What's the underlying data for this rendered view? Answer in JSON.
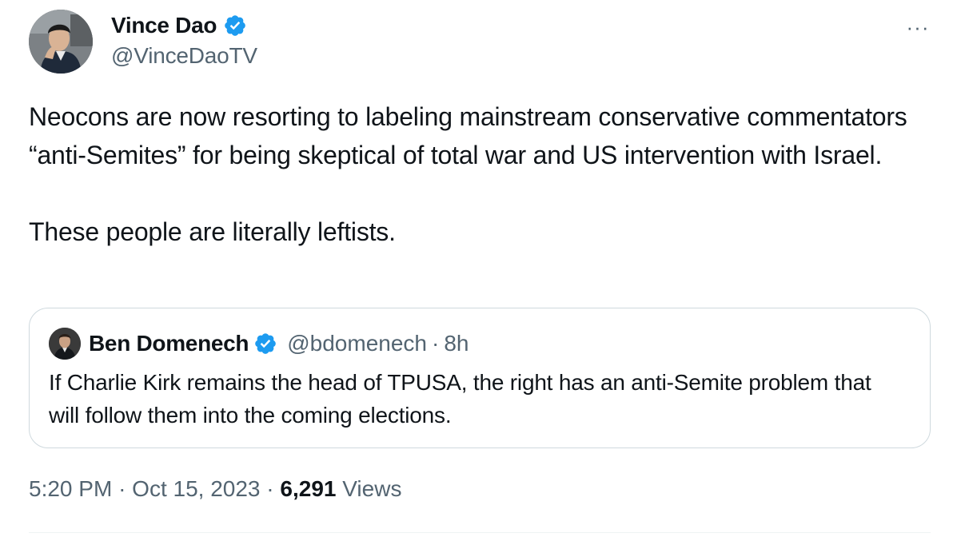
{
  "tweet": {
    "author": {
      "name": "Vince Dao",
      "handle": "@VinceDaoTV",
      "avatar_icon": "user-avatar-photo",
      "verified_icon": "verified-badge-icon",
      "verified_color": "#1d9bf0"
    },
    "more_icon": "more-options-icon",
    "more_label": "···",
    "text_paragraphs": [
      "Neocons are now resorting to labeling mainstream conservative commentators “anti-Semites” for being skeptical of total war and US intervention with Israel.",
      "These people are literally leftists."
    ],
    "quote": {
      "name": "Ben Domenech",
      "handle": "@bdomenech",
      "separator": "·",
      "time": "8h",
      "text": "If Charlie Kirk remains the head of TPUSA, the right has an anti-Semite problem that will follow them into the coming elections.",
      "avatar_icon": "user-avatar-photo",
      "verified_icon": "verified-badge-icon"
    },
    "meta": {
      "time": "5:20 PM",
      "separator": "·",
      "date": "Oct 15, 2023",
      "views_count": "6,291",
      "views_label": "Views"
    }
  },
  "colors": {
    "text_primary": "#0f1419",
    "text_secondary": "#536471",
    "border": "#cfd9de",
    "verified_blue": "#1d9bf0"
  }
}
